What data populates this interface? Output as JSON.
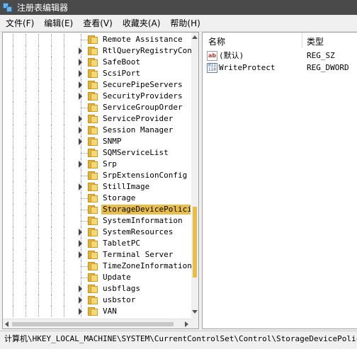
{
  "window": {
    "title": "注册表编辑器"
  },
  "menu": [
    "文件(F)",
    "编辑(E)",
    "查看(V)",
    "收藏夹(A)",
    "帮助(H)"
  ],
  "tree": {
    "items": [
      {
        "label": "Remote Assistance",
        "expandable": false,
        "selected": false
      },
      {
        "label": "RtlQueryRegistryConf",
        "expandable": true,
        "selected": false
      },
      {
        "label": "SafeBoot",
        "expandable": true,
        "selected": false
      },
      {
        "label": "ScsiPort",
        "expandable": true,
        "selected": false
      },
      {
        "label": "SecurePipeServers",
        "expandable": true,
        "selected": false
      },
      {
        "label": "SecurityProviders",
        "expandable": true,
        "selected": false
      },
      {
        "label": "ServiceGroupOrder",
        "expandable": false,
        "selected": false
      },
      {
        "label": "ServiceProvider",
        "expandable": true,
        "selected": false
      },
      {
        "label": "Session Manager",
        "expandable": true,
        "selected": false
      },
      {
        "label": "SNMP",
        "expandable": true,
        "selected": false
      },
      {
        "label": "SQMServiceList",
        "expandable": false,
        "selected": false
      },
      {
        "label": "Srp",
        "expandable": true,
        "selected": false
      },
      {
        "label": "SrpExtensionConfig",
        "expandable": false,
        "selected": false
      },
      {
        "label": "StillImage",
        "expandable": true,
        "selected": false
      },
      {
        "label": "Storage",
        "expandable": false,
        "selected": false
      },
      {
        "label": "StorageDevicePolicie",
        "expandable": false,
        "selected": true
      },
      {
        "label": "SystemInformation",
        "expandable": false,
        "selected": false
      },
      {
        "label": "SystemResources",
        "expandable": true,
        "selected": false
      },
      {
        "label": "TabletPC",
        "expandable": true,
        "selected": false
      },
      {
        "label": "Terminal Server",
        "expandable": true,
        "selected": false
      },
      {
        "label": "TimeZoneInformation",
        "expandable": false,
        "selected": false
      },
      {
        "label": "Update",
        "expandable": false,
        "selected": false
      },
      {
        "label": "usbflags",
        "expandable": true,
        "selected": false
      },
      {
        "label": "usbstor",
        "expandable": true,
        "selected": false
      },
      {
        "label": "VAN",
        "expandable": true,
        "selected": false
      }
    ]
  },
  "list": {
    "columns": {
      "name": "名称",
      "type": "类型"
    },
    "rows": [
      {
        "icon": "string-value-icon",
        "icon_text": "ab",
        "name": "(默认)",
        "type": "REG_SZ"
      },
      {
        "icon": "binary-value-icon",
        "icon_text": "011 110",
        "name": "WriteProtect",
        "type": "REG_DWORD"
      }
    ]
  },
  "status": {
    "path": "计算机\\HKEY_LOCAL_MACHINE\\SYSTEM\\CurrentControlSet\\Control\\StorageDevicePolicies"
  }
}
